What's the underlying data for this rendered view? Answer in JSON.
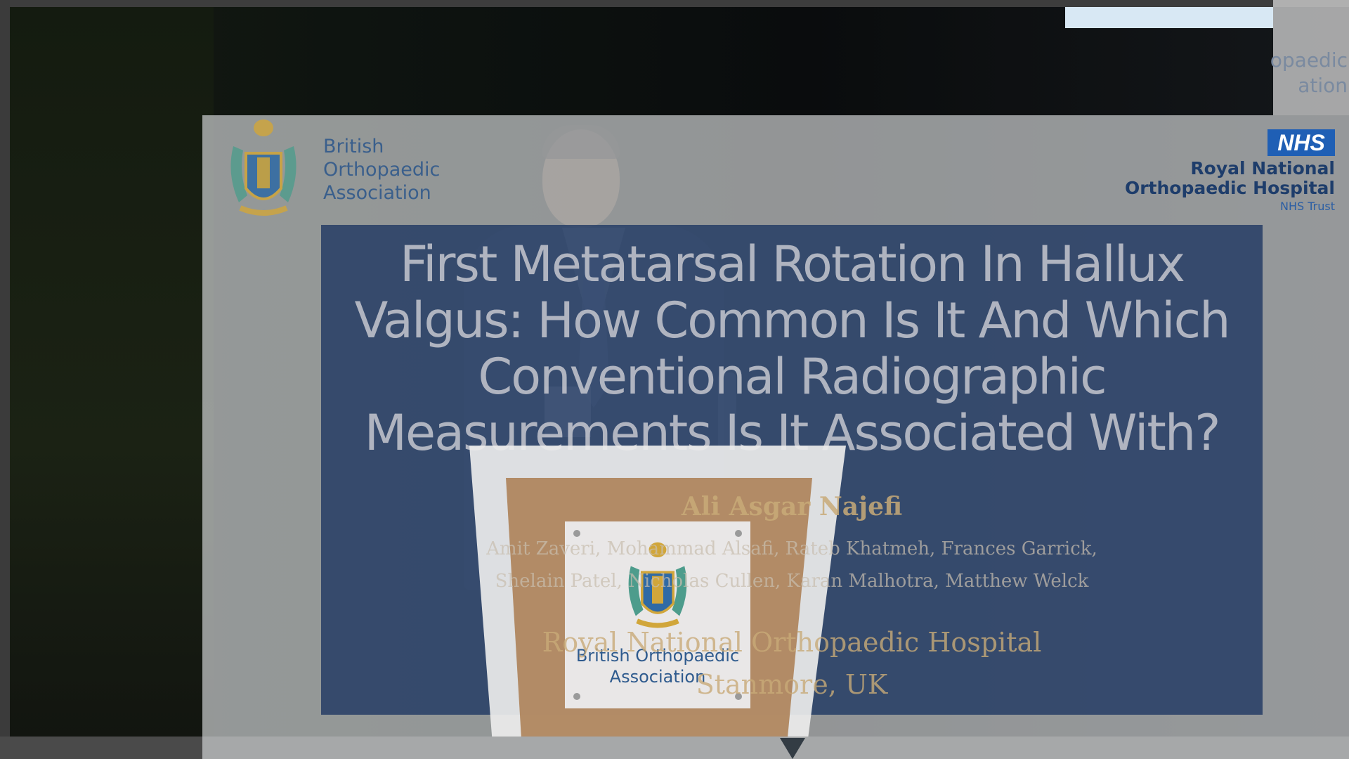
{
  "background": {
    "org_text_lines": [
      "opaedic",
      "ation"
    ]
  },
  "slide": {
    "boa_lines": [
      "British",
      "Orthopaedic",
      "Association"
    ],
    "nhs_badge": "NHS",
    "rnoh_lines": [
      "Royal National",
      "Orthopaedic Hospital"
    ],
    "rnoh_trust": "NHS Trust",
    "title_lines": [
      "First Metatarsal Rotation In Hallux",
      "Valgus: How Common Is It And Which",
      "Conventional Radiographic",
      "Measurements Is It Associated With?"
    ],
    "presenter": "Ali Asgar Najefi",
    "coauthor_lines": [
      "Amit Zaveri, Mohammad Alsafi, Rateb Khatmeh, Frances Garrick,",
      "Shelain Patel, Nicholas Cullen, Karan Malhotra, Matthew Welck"
    ],
    "institution_lines": [
      "Royal National Orthopaedic Hospital",
      "Stanmore, UK"
    ]
  },
  "lectern": {
    "sign_lines": [
      "British Orthopaedic",
      "Association"
    ]
  },
  "colors": {
    "slide_panel": "#1e3762",
    "boa_blue": "#3a5f8c",
    "nhs_blue": "#1f5fb5",
    "lectern_wood": "#aa7d50"
  }
}
